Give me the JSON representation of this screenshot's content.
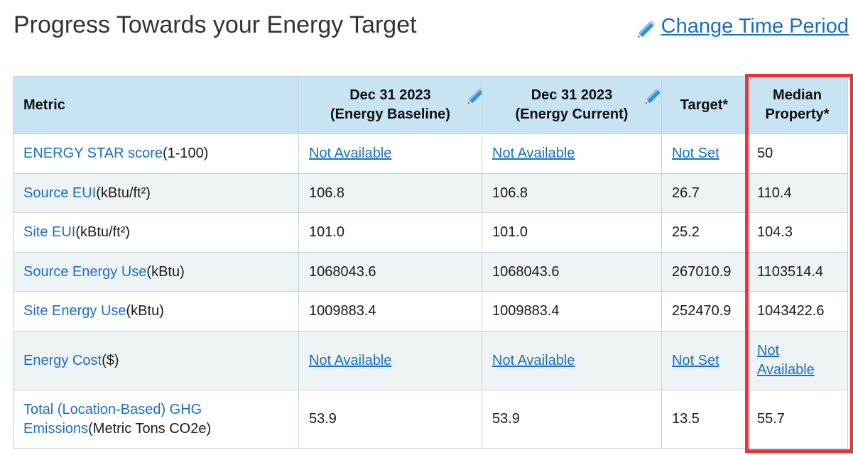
{
  "header": {
    "title": "Progress Towards your Energy Target",
    "change_period_label": "Change Time Period"
  },
  "table": {
    "columns": [
      {
        "line1": "Metric",
        "line2": ""
      },
      {
        "line1": "Dec 31 2023",
        "line2": "(Energy Baseline)"
      },
      {
        "line1": "Dec 31 2023",
        "line2": "(Energy Current)"
      },
      {
        "line1": "Target*",
        "line2": ""
      },
      {
        "line1": "Median",
        "line2": "Property*"
      }
    ],
    "rows": [
      {
        "metric_line1": "ENERGY STAR score",
        "metric_line2": "",
        "unit": "(1-100)",
        "baseline": "Not Available",
        "current": "Not Available",
        "target": "Not Set",
        "median": "50"
      },
      {
        "metric_line1": "Source EUI",
        "metric_line2": "",
        "unit": "(kBtu/ft²)",
        "baseline": "106.8",
        "current": "106.8",
        "target": "26.7",
        "median": "110.4"
      },
      {
        "metric_line1": "Site EUI",
        "metric_line2": "",
        "unit": "(kBtu/ft²)",
        "baseline": "101.0",
        "current": "101.0",
        "target": "25.2",
        "median": "104.3"
      },
      {
        "metric_line1": "Source Energy Use",
        "metric_line2": "",
        "unit": "(kBtu)",
        "baseline": "1068043.6",
        "current": "1068043.6",
        "target": "267010.9",
        "median": "1103514.4"
      },
      {
        "metric_line1": "Site Energy Use",
        "metric_line2": "",
        "unit": "(kBtu)",
        "baseline": "1009883.4",
        "current": "1009883.4",
        "target": "252470.9",
        "median": "1043422.6"
      },
      {
        "metric_line1": "Energy Cost",
        "metric_line2": "",
        "unit": "($)",
        "baseline": "Not Available",
        "current": "Not Available",
        "target": "Not Set",
        "median_line1": "Not",
        "median_line2": "Available"
      },
      {
        "metric_line1": "Total (Location-Based) GHG",
        "metric_line2": "Emissions",
        "unit": "(Metric Tons CO2e)",
        "baseline": "53.9",
        "current": "53.9",
        "target": "13.5",
        "median": "55.7"
      }
    ]
  },
  "icons": {
    "edit": "pencil-icon"
  },
  "colors": {
    "link": "#1a6fc2",
    "header_bg": "#c8e3f1",
    "row_alt_bg": "#eef3f6",
    "highlight": "#e8343b"
  }
}
